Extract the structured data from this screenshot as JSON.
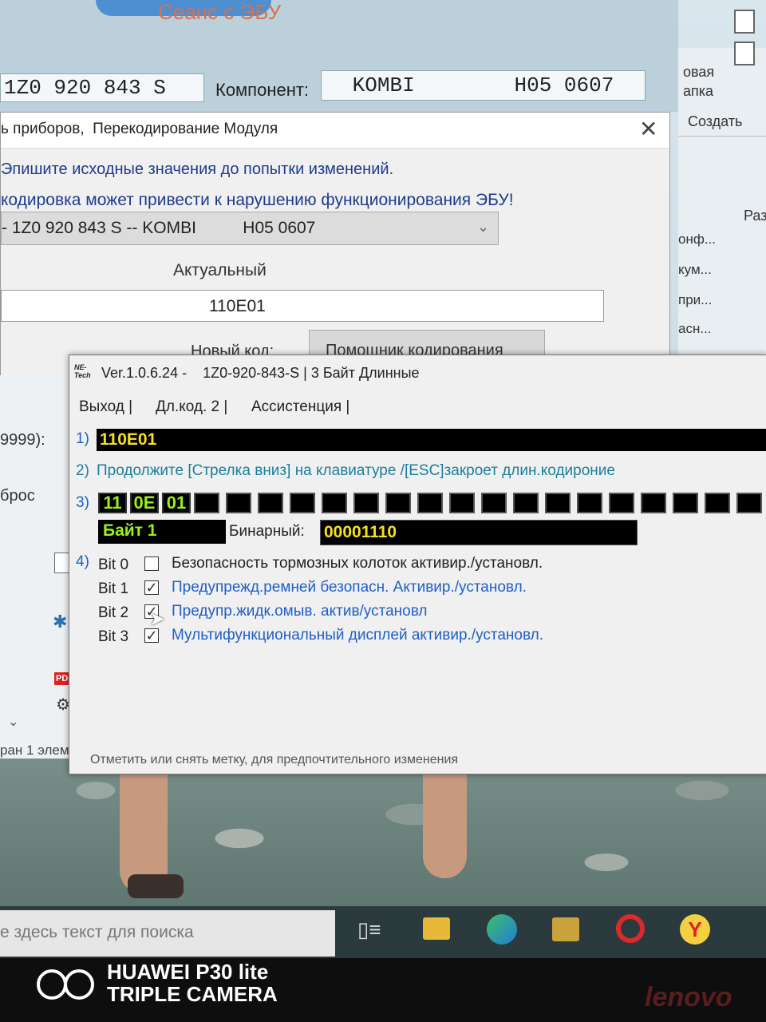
{
  "ecu_window": {
    "title": "Сеанс с ЭБУ",
    "part_number": "1Z0 920 843 S",
    "component_label": "Компонент:",
    "component_value": "KOMBI        H05 0607"
  },
  "explorer": {
    "new_folder_line1": "овая",
    "new_folder_line2": "апка",
    "create": "Создать",
    "col_label": "Раз",
    "items": [
      "онф...",
      "кум...",
      "при...",
      "асн..."
    ]
  },
  "recode_dialog": {
    "title": "ь приборов,  Перекодирование Модуля",
    "warning_line1": "Эпишите исходные значения до попытки изменений.",
    "warning_line2": "кодировка может привести к нарушению функционирования ЭБУ!",
    "module_select": "- 1Z0 920 843 S -- KOMBI          H05 0607",
    "actual_label": "Актуальный",
    "actual_value": "110E01",
    "new_code_label": "Новый код:",
    "assistant_button": "Помощник кодирования"
  },
  "side_panel": {
    "range_label": "9999):",
    "reset_label": "брос",
    "status": "ран 1 элем"
  },
  "tech_dialog": {
    "logo": "NE-Tech",
    "title": "Ver.1.0.6.24 -    1Z0-920-843-S | 3 Байт Длинные",
    "menu": [
      "Выход |",
      "Дл.код. 2 |",
      "Ассистенция |"
    ],
    "row1_num": "1)",
    "row1_value": "110E01",
    "row2_num": "2)",
    "row2_text": "Продолжите [Стрелка вниз] на клавиатуре /[ESC]закроет длин.кодироние",
    "row3_num": "3)",
    "bytes": [
      "11",
      "0E",
      "01"
    ],
    "empty_cells": 18,
    "byte_label": "Байт 1",
    "binary_label": "Бинарный:",
    "binary_value": "00001110",
    "row4_num": "4)",
    "bits": [
      {
        "label": "Bit 0",
        "checked": false,
        "text": "Безопасность тормозных колоток активир./установл."
      },
      {
        "label": "Bit 1",
        "checked": true,
        "text": "Предупрежд.ремней безопасн. Активир./установл."
      },
      {
        "label": "Bit 2",
        "checked": true,
        "text": "Предупр.жидк.омыв. актив/установл"
      },
      {
        "label": "Bit 3",
        "checked": true,
        "text": "Мультифункциональный дисплей активир./установл."
      }
    ],
    "status_hint": "Отметить или снять метку, для предпочтительного изменения"
  },
  "taskbar": {
    "search_placeholder": "е здесь текст для поиска"
  },
  "photo_overlay": {
    "brand": "HUAWEI P30 lite",
    "camera": "TRIPLE CAMERA",
    "laptop": "lenovo"
  },
  "colors": {
    "yellow_text": "#f7e21a",
    "green_text": "#9ef01a",
    "blue_text": "#1f5fc8",
    "cyan_text": "#1b7f9c"
  }
}
